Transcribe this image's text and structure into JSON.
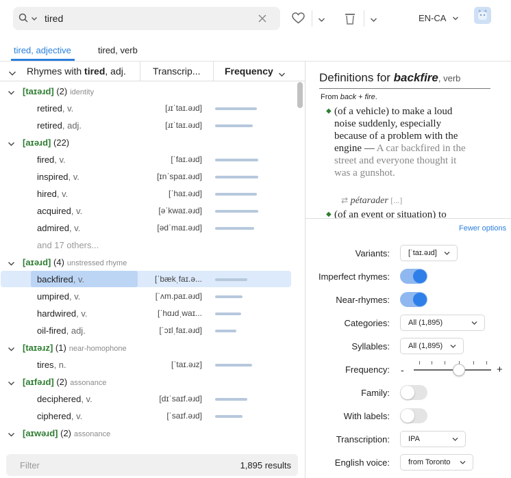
{
  "search": {
    "value": "tired",
    "placeholder": ""
  },
  "lang": {
    "label": "EN-CA"
  },
  "tabs": [
    {
      "label": "tired, adjective",
      "active": true
    },
    {
      "label": "tired, verb",
      "active": false
    }
  ],
  "columns": {
    "rhymes_prefix": "Rhymes with ",
    "rhymes_word": "tired",
    "rhymes_suffix": ", adj.",
    "transcription": "Transcrip...",
    "frequency": "Frequency"
  },
  "groups": [
    {
      "ipa": "[taɪəɹd]",
      "count": "(2)",
      "note": "identity",
      "rows": [
        {
          "word": "retired",
          "pos": ", v.",
          "ipa": "[ɹɪˈtaɪ.əɹd]",
          "freq": 0.56
        },
        {
          "word": "retired",
          "pos": ", adj.",
          "ipa": "[ɹɪˈtaɪ.əɹd]",
          "freq": 0.5
        }
      ]
    },
    {
      "ipa": "[aɪəɹd]",
      "count": "(22)",
      "note": "",
      "rows": [
        {
          "word": "fired",
          "pos": ", v.",
          "ipa": "[ˈfaɪ.əɹd]",
          "freq": 0.58
        },
        {
          "word": "inspired",
          "pos": ", v.",
          "ipa": "[ɪnˈspaɪ.əɹd]",
          "freq": 0.58
        },
        {
          "word": "hired",
          "pos": ", v.",
          "ipa": "[ˈhaɪ.əɹd]",
          "freq": 0.56
        },
        {
          "word": "acquired",
          "pos": ", v.",
          "ipa": "[əˈkwaɪ.əɹd]",
          "freq": 0.58
        },
        {
          "word": "admired",
          "pos": ", v.",
          "ipa": "[ədˈmaɪ.əɹd]",
          "freq": 0.52
        }
      ],
      "more": "and 17 others..."
    },
    {
      "ipa": "[aɪəɹd]",
      "count": "(4)",
      "note": "unstressed rhyme",
      "rows": [
        {
          "word": "backfired",
          "pos": ", v.",
          "ipa": "[ˈbækˌfaɪ.ə...",
          "freq": 0.43,
          "selected": true
        },
        {
          "word": "umpired",
          "pos": ", v.",
          "ipa": "[ˈʌm.paɪ.əɹd]",
          "freq": 0.37
        },
        {
          "word": "hardwired",
          "pos": ", v.",
          "ipa": "[ˈhɑɹdˌwaɪ...",
          "freq": 0.35
        },
        {
          "word": "oil-fired",
          "pos": ", adj.",
          "ipa": "[ˈɔɪlˌfaɪ.əɹd]",
          "freq": 0.28
        }
      ]
    },
    {
      "ipa": "[taɪəɹz]",
      "count": "(1)",
      "note": "near-homophone",
      "rows": [
        {
          "word": "tires",
          "pos": ", n.",
          "ipa": "[ˈtaɪ.əɹz]",
          "freq": 0.49
        }
      ]
    },
    {
      "ipa": "[aɪfəɹd]",
      "count": "(2)",
      "note": "assonance",
      "rows": [
        {
          "word": "deciphered",
          "pos": ", v.",
          "ipa": "[dɪˈsaɪf.əɹd]",
          "freq": 0.43
        },
        {
          "word": "ciphered",
          "pos": ", v.",
          "ipa": "[ˈsaɪf.əɹd]",
          "freq": 0.37
        }
      ]
    },
    {
      "ipa": "[aɪwəɹd]",
      "count": "(2)",
      "note": "assonance",
      "rows": []
    }
  ],
  "filter": {
    "placeholder": "Filter",
    "count": "1,895 results"
  },
  "definition": {
    "title_prefix": "Definitions for ",
    "word": "backfire",
    "pos": ", verb",
    "from_prefix": "From ",
    "from_etym": "back + fire",
    "from_suffix": ".",
    "sense1": "(of a vehicle) to make a loud noise suddenly, especially because of a problem with the engine — ",
    "sense1_example": "A car backfired in the street and everyone thought it was a gunshot.",
    "translation": "pétarader",
    "translation_more": "[...]",
    "sense2": "(of an event or situation) to"
  },
  "options": {
    "fewer": "Fewer options",
    "variants": {
      "label": "Variants:",
      "value": "[ˈtaɪ.əɹd]"
    },
    "imperfect": {
      "label": "Imperfect rhymes:",
      "on": true
    },
    "near": {
      "label": "Near-rhymes:",
      "on": true
    },
    "categories": {
      "label": "Categories:",
      "value": "All (1,895)"
    },
    "syllables": {
      "label": "Syllables:",
      "value": "All (1,895)"
    },
    "frequency": {
      "label": "Frequency:",
      "minus": "-",
      "plus": "+",
      "level": 0.6
    },
    "family": {
      "label": "Family:",
      "on": false
    },
    "with_labels": {
      "label": "With labels:",
      "on": false
    },
    "transcription": {
      "label": "Transcription:",
      "value": "IPA"
    },
    "voice": {
      "label": "English voice:",
      "value": "from Toronto"
    }
  },
  "colors": {
    "accent": "#2a7fdc",
    "ipa_green": "#2e7d32",
    "freq_bar": "#b6c8dd",
    "selected_row": "#ddeafb"
  }
}
